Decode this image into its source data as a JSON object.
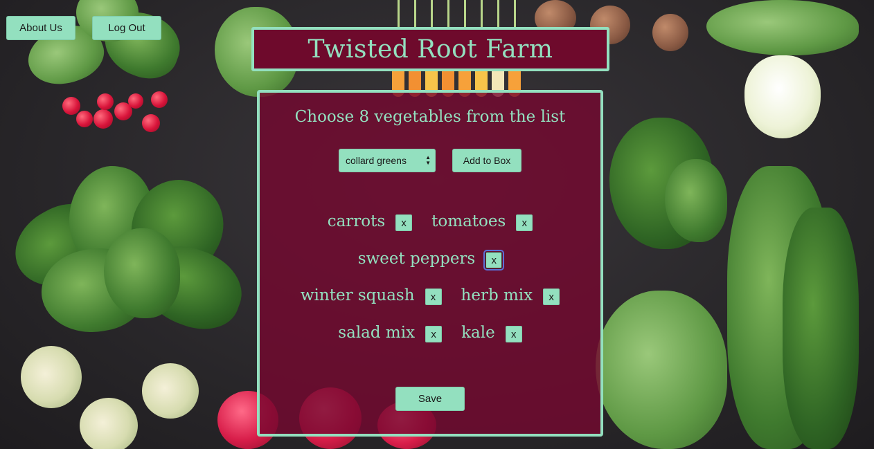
{
  "nav": {
    "about_label": "About Us",
    "logout_label": "Log Out"
  },
  "header": {
    "title": "Twisted Root Farm"
  },
  "picker": {
    "prompt": "Choose 8 vegetables from the list",
    "selected_option": "collard greens",
    "add_label": "Add to Box"
  },
  "box": {
    "remove_label": "x",
    "rows": [
      [
        "carrots",
        "tomatoes"
      ],
      [
        "sweet peppers"
      ],
      [
        "winter squash",
        "herb mix"
      ],
      [
        "salad mix",
        "kale"
      ]
    ]
  },
  "save_label": "Save",
  "colors": {
    "accent": "#93e0bf",
    "panel": "#760830",
    "focus_ring": "#5b6fd6"
  }
}
